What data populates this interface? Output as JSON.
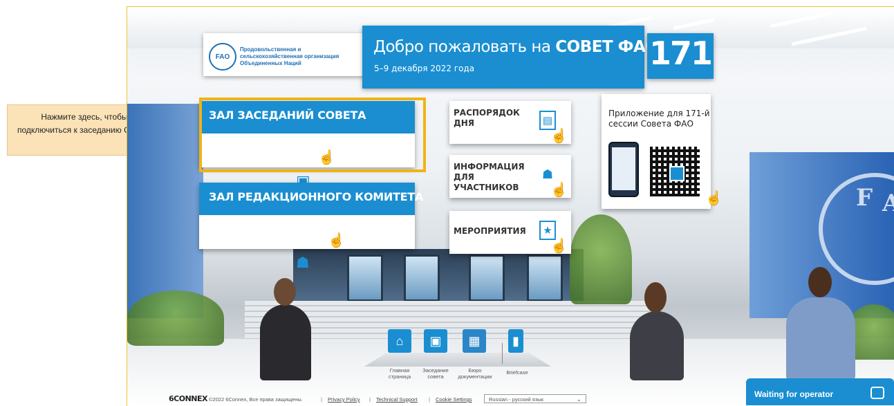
{
  "header": {
    "org_name": "Продовольственная и сельскохозяйственная организация Объединенных Наций",
    "emblem_text": "FAO",
    "welcome_prefix": "Добро пожаловать на ",
    "welcome_bold": "СОВЕТ ФАО",
    "dates": "5–9 декабря 2022 года",
    "session_number": "171"
  },
  "main_buttons": [
    {
      "label": "ЗАЛ ЗАСЕДАНИЙ СОВЕТА",
      "icon": "conference-icon"
    },
    {
      "label": "ЗАЛ РЕДАКЦИОННОГО КОМИТЕТА",
      "icon": "group-icon"
    }
  ],
  "cards": [
    {
      "label": "РАСПОРЯДОК ДНЯ",
      "icon": "agenda-book-icon"
    },
    {
      "label": "ИНФОРМАЦИЯ ДЛЯ УЧАСТНИКОВ",
      "icon": "participants-icon"
    },
    {
      "label": "МЕРОПРИЯТИЯ",
      "icon": "calendar-icon"
    }
  ],
  "app_card": {
    "title": "Приложение для 171-й сессии Совета ФАО"
  },
  "bottom_nav": [
    {
      "label": "Главная страница",
      "icon": "home-icon"
    },
    {
      "label": "Заседание совета",
      "icon": "conference-icon"
    },
    {
      "label": "Бюро документации",
      "icon": "documents-icon"
    },
    {
      "label": "Briefcase",
      "icon": "briefcase-icon"
    }
  ],
  "footer": {
    "brand": "6CONNEX",
    "copyright": "©2022 6Connex, Все права защищены.",
    "links": [
      "Privacy Policy",
      "Technical Support",
      "Cookie Settings"
    ],
    "language_selected": "Russian - русский язык"
  },
  "chat": {
    "status": "Waiting for operator"
  },
  "callout": {
    "text": "Нажмите здесь, чтобы подключиться к заседанию Совета"
  },
  "colors": {
    "brand_blue": "#1a8ed1",
    "highlight": "#f1b314",
    "callout_bg": "#fbe3b7"
  }
}
